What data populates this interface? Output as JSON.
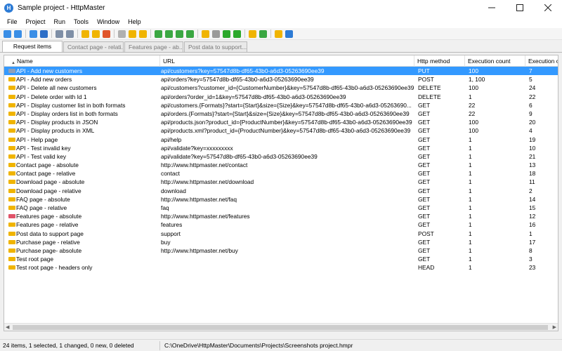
{
  "window": {
    "title": "Sample project - HttpMaster",
    "app_icon": "httpmaster-logo-icon",
    "app_icon_glyph": "H"
  },
  "menu": [
    "File",
    "Project",
    "Run",
    "Tools",
    "Window",
    "Help"
  ],
  "toolbar_icons": [
    {
      "name": "add-item-icon",
      "color": "#3a8ee6"
    },
    {
      "name": "add-duplicate-icon",
      "color": "#3a8ee6"
    },
    {
      "name": "edit-item-icon",
      "color": "#3a8ee6"
    },
    {
      "name": "save-icon",
      "color": "#2e6fc7"
    },
    {
      "name": "list-view-icon",
      "color": "#7f8fa6"
    },
    {
      "name": "copy-icon",
      "color": "#7f8fa6"
    },
    {
      "name": "add-folder-icon",
      "color": "#f0b400"
    },
    {
      "name": "search-folder-icon",
      "color": "#f0b400"
    },
    {
      "name": "delete-icon",
      "color": "#e0542b"
    },
    {
      "name": "move-icon",
      "color": "#b0b0b0"
    },
    {
      "name": "comment-icon",
      "color": "#f0b400"
    },
    {
      "name": "folder-icon",
      "color": "#f0b400"
    },
    {
      "name": "run-selected-icon",
      "color": "#3aa742"
    },
    {
      "name": "run-list-icon",
      "color": "#3aa742"
    },
    {
      "name": "run-list-all-icon",
      "color": "#3aa742"
    },
    {
      "name": "run-split-icon",
      "color": "#3aa742"
    },
    {
      "name": "chart-icon",
      "color": "#f0b400"
    },
    {
      "name": "arrow-right-icon",
      "color": "#9a9a9a"
    },
    {
      "name": "play-icon",
      "color": "#2ba82b"
    },
    {
      "name": "play-all-icon",
      "color": "#2ba82b"
    },
    {
      "name": "settings-person-icon",
      "color": "#f0b400"
    },
    {
      "name": "resize-icon",
      "color": "#3aa742"
    },
    {
      "name": "options-gear-icon",
      "color": "#f0b400"
    },
    {
      "name": "help-icon",
      "color": "#2d7bd5"
    }
  ],
  "tabs": [
    {
      "label": "Request items",
      "active": true
    },
    {
      "label": "Contact page - relati...",
      "active": false
    },
    {
      "label": "Features page - ab...*",
      "active": false
    },
    {
      "label": "Post data to support...",
      "active": false
    }
  ],
  "columns": {
    "name": "Name",
    "url": "URL",
    "method": "Http method",
    "exec": "Execution count",
    "order": "Execution or"
  },
  "rows": [
    {
      "name": "API - Add new customers",
      "url": "api/customers?key=57547d8b-df65-43b0-a6d3-05263690ee39",
      "method": "PUT",
      "exec": "100",
      "order": "7",
      "icon": "#7f8fa6"
    },
    {
      "name": "API - Add new orders",
      "url": "api/orders?key=57547d8b-df65-43b0-a6d3-05263690ee39",
      "method": "POST",
      "exec": "1, 100",
      "order": "5",
      "icon": "#f0b400"
    },
    {
      "name": "API - Delete all new customers",
      "url": "api/customers?customer_id={CustomerNumber}&key=57547d8b-df65-43b0-a6d3-05263690ee39",
      "method": "DELETE",
      "exec": "100",
      "order": "24",
      "icon": "#f0b400"
    },
    {
      "name": "API - Delete order with Id 1",
      "url": "api/orders?order_id=1&key=57547d8b-df65-43b0-a6d3-05263690ee39",
      "method": "DELETE",
      "exec": "1",
      "order": "22",
      "icon": "#f0b400"
    },
    {
      "name": "API - Display customer list in both formats",
      "url": "api/customers.{Formats}?start={Start}&size={Size}&key=57547d8b-df65-43b0-a6d3-05263690...",
      "method": "GET",
      "exec": "22",
      "order": "6",
      "icon": "#f0b400"
    },
    {
      "name": "API - Display orders list in both formats",
      "url": "api/orders.{Formats}?start={Start}&size={Size}&key=57547d8b-df65-43b0-a6d3-05263690ee39",
      "method": "GET",
      "exec": "22",
      "order": "9",
      "icon": "#f0b400"
    },
    {
      "name": "API - Display products in JSON",
      "url": "api/products.json?product_id={ProductNumber}&key=57547d8b-df65-43b0-a6d3-05263690ee39",
      "method": "GET",
      "exec": "100",
      "order": "20",
      "icon": "#f0b400"
    },
    {
      "name": "API - Display products in XML",
      "url": "api/products.xml?product_id={ProductNumber}&key=57547d8b-df65-43b0-a6d3-05263690ee39",
      "method": "GET",
      "exec": "100",
      "order": "4",
      "icon": "#f0b400"
    },
    {
      "name": "API - Help page",
      "url": "api/help",
      "method": "GET",
      "exec": "1",
      "order": "19",
      "icon": "#f0b400"
    },
    {
      "name": "API - Test invalid key",
      "url": "api/validate?key=xxxxxxxxx",
      "method": "GET",
      "exec": "1",
      "order": "10",
      "icon": "#f0b400"
    },
    {
      "name": "API - Test valid key",
      "url": "api/validate?key=57547d8b-df65-43b0-a6d3-05263690ee39",
      "method": "GET",
      "exec": "1",
      "order": "21",
      "icon": "#f0b400"
    },
    {
      "name": "Contact page - absolute",
      "url": "http://www.httpmaster.net/contact",
      "method": "GET",
      "exec": "1",
      "order": "13",
      "icon": "#f0b400"
    },
    {
      "name": "Contact page - relative",
      "url": "contact",
      "method": "GET",
      "exec": "1",
      "order": "18",
      "icon": "#f0b400"
    },
    {
      "name": "Download page - absolute",
      "url": "http://www.httpmaster.net/download",
      "method": "GET",
      "exec": "1",
      "order": "11",
      "icon": "#f0b400"
    },
    {
      "name": "Download page - relative",
      "url": "download",
      "method": "GET",
      "exec": "1",
      "order": "2",
      "icon": "#f0b400"
    },
    {
      "name": "FAQ page - absolute",
      "url": "http://www.httpmaster.net/faq",
      "method": "GET",
      "exec": "1",
      "order": "14",
      "icon": "#f0b400"
    },
    {
      "name": "FAQ page - relative",
      "url": "faq",
      "method": "GET",
      "exec": "1",
      "order": "15",
      "icon": "#f0b400"
    },
    {
      "name": "Features page - absolute",
      "url": "http://www.httpmaster.net/features",
      "method": "GET",
      "exec": "1",
      "order": "12",
      "icon": "#e0546a"
    },
    {
      "name": "Features page - relative",
      "url": "features",
      "method": "GET",
      "exec": "1",
      "order": "16",
      "icon": "#f0b400"
    },
    {
      "name": "Post data to support page",
      "url": "support",
      "method": "POST",
      "exec": "1",
      "order": "1",
      "icon": "#f0b400"
    },
    {
      "name": "Purchase page - relative",
      "url": "buy",
      "method": "GET",
      "exec": "1",
      "order": "17",
      "icon": "#f0b400"
    },
    {
      "name": "Purchase page- absolute",
      "url": "http://www.httpmaster.net/buy",
      "method": "GET",
      "exec": "1",
      "order": "8",
      "icon": "#f0b400"
    },
    {
      "name": "Test root page",
      "url": "",
      "method": "GET",
      "exec": "1",
      "order": "3",
      "icon": "#f0b400"
    },
    {
      "name": "Test root page - headers only",
      "url": "",
      "method": "HEAD",
      "exec": "1",
      "order": "23",
      "icon": "#f0b400"
    }
  ],
  "selected_row": 0,
  "status": {
    "summary": "24 items, 1 selected, 1 changed, 0 new, 0 deleted",
    "path": "C:\\OneDrive\\HttpMaster\\Documents\\Projects\\Screenshots project.hmpr"
  },
  "colors": {
    "selection": "#3399ff",
    "accent": "#2d7bd5"
  }
}
